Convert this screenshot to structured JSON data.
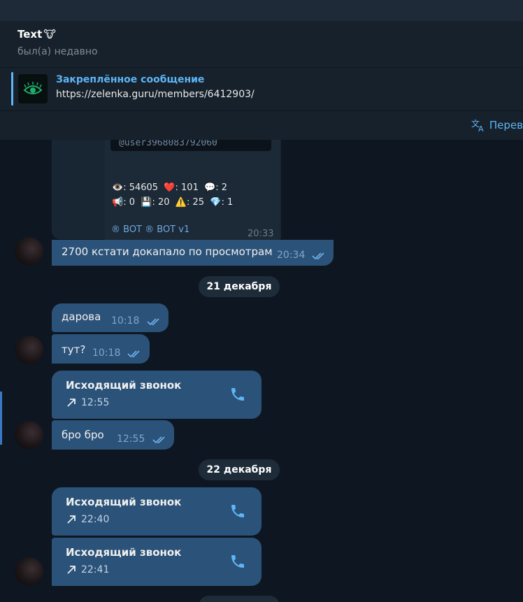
{
  "header": {
    "title": "Text",
    "title_emoji": "🐮",
    "status": "был(а) недавно"
  },
  "pinned": {
    "title": "Закреплённое сообщение",
    "text": "https://zelenka.guru/members/6412903/"
  },
  "translate": {
    "label": "Перев"
  },
  "media_message": {
    "code": "@user3968083792060",
    "stats_line1": [
      {
        "icon": "👁️",
        "value": ": 54605"
      },
      {
        "icon": "❤️",
        "value": ": 101"
      },
      {
        "icon": "💬",
        "value": ": 2"
      }
    ],
    "stats_line2": [
      {
        "icon": "📢",
        "value": ": 0"
      },
      {
        "icon": "💾",
        "value": ": 20"
      },
      {
        "icon": "⚠️",
        "value": ": 25"
      },
      {
        "icon": "💎",
        "value": ": 1"
      }
    ],
    "bot_text": "® BOT  ® BOT v1",
    "time": "20:33"
  },
  "messages": [
    {
      "text": "2700 кстати докапало по просмотрам",
      "time": "20:34"
    },
    {
      "text": "дарова",
      "time": "10:18"
    },
    {
      "text": "тут?",
      "time": "10:18"
    },
    {
      "text": "бро бро",
      "time": "12:55"
    }
  ],
  "dates": [
    "21 декабря",
    "22 декабря"
  ],
  "calls": [
    {
      "title": "Исходящий звонок",
      "time": "12:55"
    },
    {
      "title": "Исходящий звонок",
      "time": "22:40"
    },
    {
      "title": "Исходящий звонок",
      "time": "22:41"
    }
  ],
  "colors": {
    "background": "#0e1621",
    "header": "#17212b",
    "outgoing_bubble": "#2b5278",
    "accent": "#5eb5f7"
  }
}
